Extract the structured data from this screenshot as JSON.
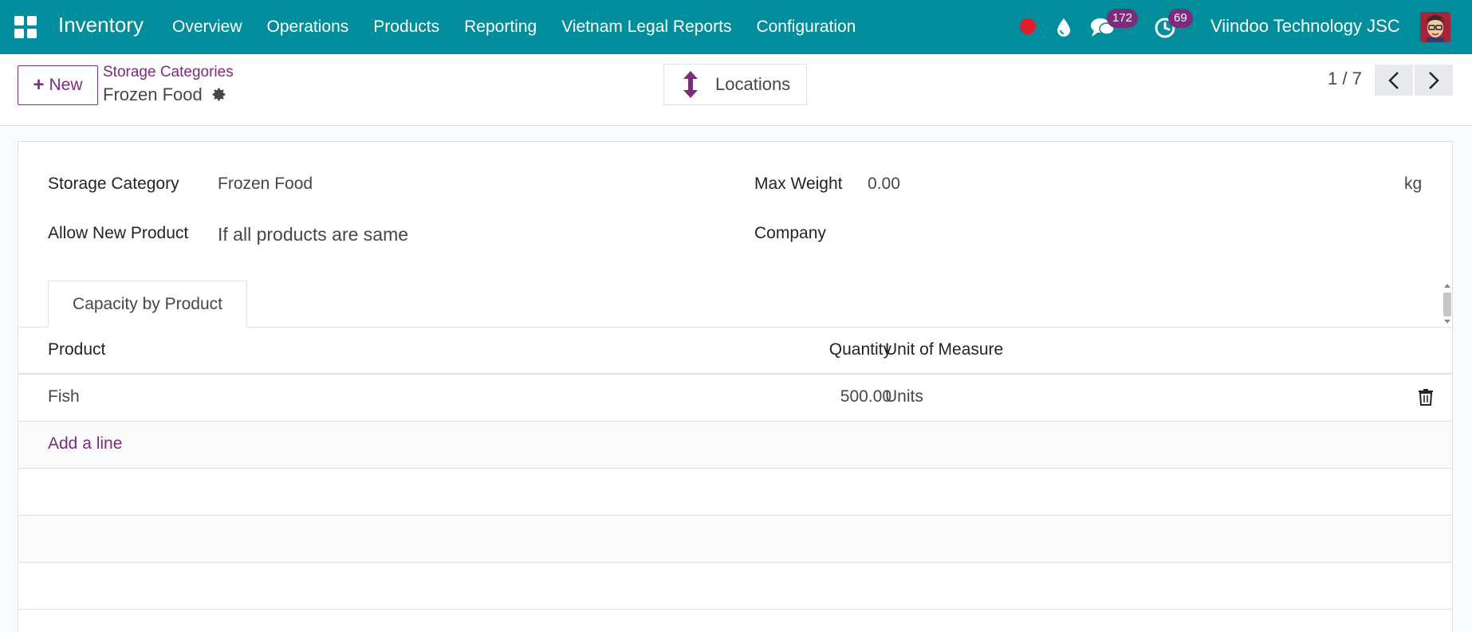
{
  "navbar": {
    "app_name": "Inventory",
    "menu": [
      "Overview",
      "Operations",
      "Products",
      "Reporting",
      "Vietnam Legal Reports",
      "Configuration"
    ],
    "messages_count": "172",
    "activities_count": "69",
    "company": "Viindoo Technology JSC",
    "icons": [
      "apps-icon",
      "recording-dot-icon",
      "drop-icon",
      "chat-icon",
      "clock-icon",
      "avatar"
    ]
  },
  "control": {
    "new_label": "New",
    "breadcrumb_parent": "Storage Categories",
    "breadcrumb_current": "Frozen Food",
    "locations_label": "Locations",
    "pager": "1 / 7"
  },
  "form": {
    "storage_category_label": "Storage Category",
    "storage_category_value": "Frozen Food",
    "allow_new_product_label": "Allow New Product",
    "allow_new_product_value": "If all products are same",
    "max_weight_label": "Max Weight",
    "max_weight_value": "0.00",
    "max_weight_unit": "kg",
    "company_label": "Company",
    "company_value": ""
  },
  "tabs": [
    "Capacity by Product"
  ],
  "table": {
    "columns": [
      "Product",
      "Quantity",
      "Unit of Measure"
    ],
    "rows": [
      {
        "product": "Fish",
        "quantity": "500.00",
        "uom": "Units"
      }
    ],
    "add_line": "Add a line"
  },
  "colors": {
    "navbar": "#018d9b",
    "accent": "#7c2b7d",
    "recording": "#e11d2d"
  }
}
